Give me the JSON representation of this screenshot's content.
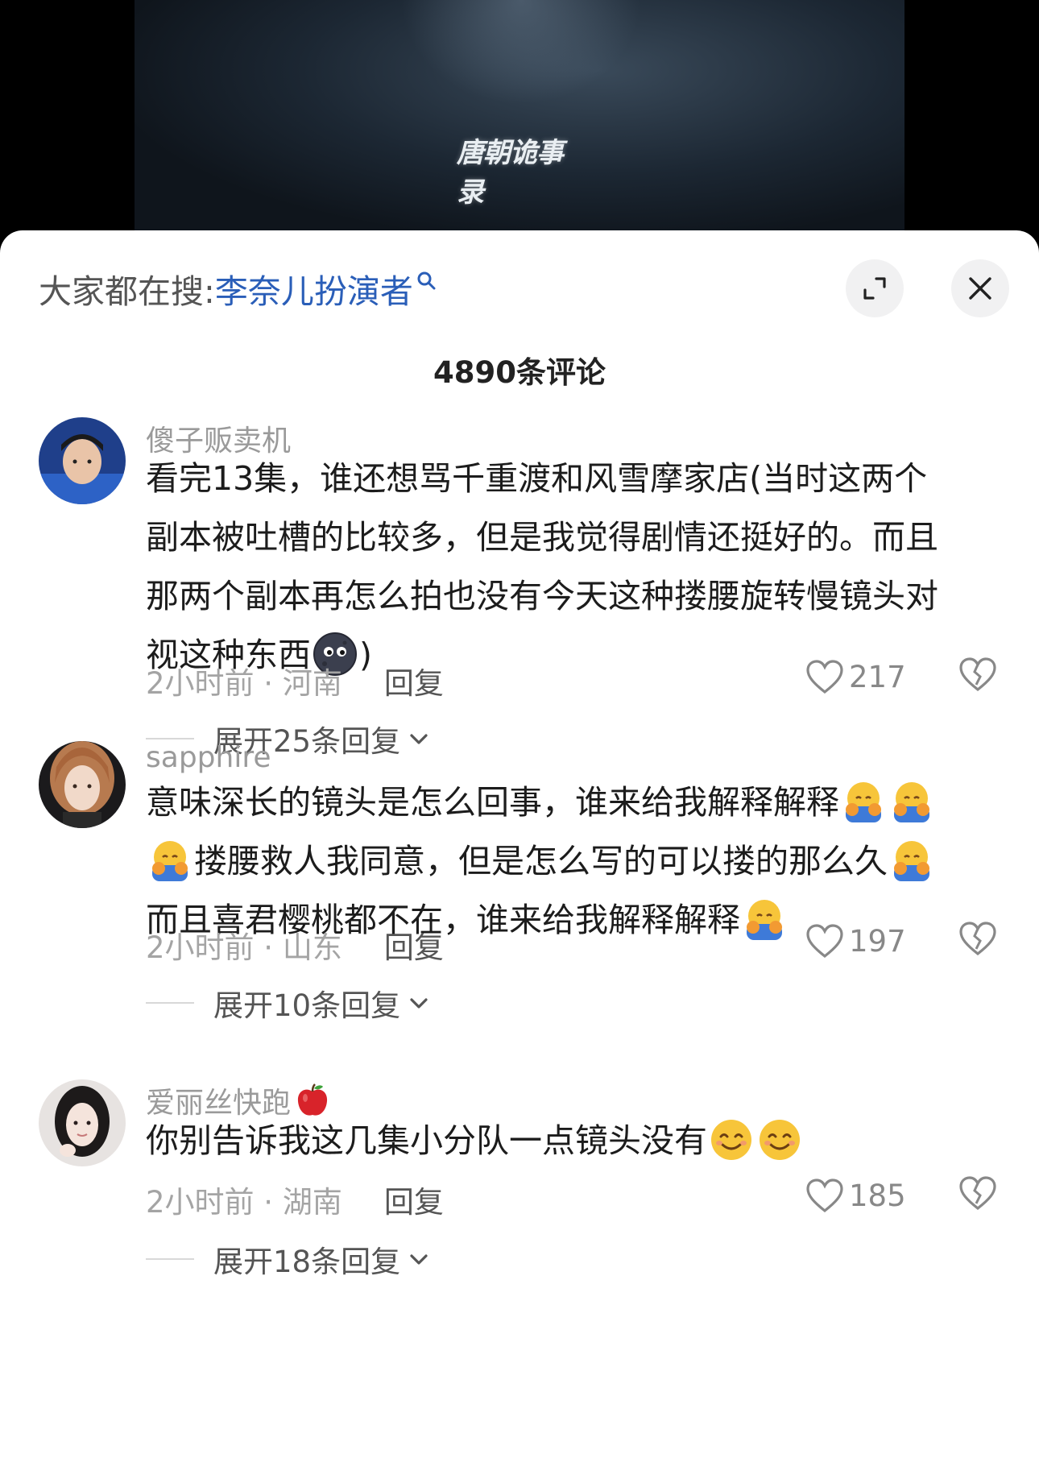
{
  "video": {
    "logo_text": "唐朝诡事录"
  },
  "search_hint": {
    "prefix": "大家都在搜:",
    "term": "李奈儿扮演者"
  },
  "comment_count": "4890条评论",
  "comments": [
    {
      "username": "傻子贩卖机",
      "lines": [
        "看完13集，谁还想骂千重渡和风雪摩家店(当时这两个",
        "副本被吐槽的比较多，但是我觉得剧情还挺好的。而且",
        "那两个副本再怎么拍也没有今天这种搂腰旋转慢镜头对",
        "视这种东西"
      ],
      "line4_tail": ")",
      "time_location": "2小时前 · 河南",
      "reply_label": "回复",
      "likes": "217",
      "expand_label": "展开25条回复"
    },
    {
      "username": "sapphire",
      "lines": [
        "意味深长的镜头是怎么回事，谁来给我解释解释",
        "搂腰救人我同意，但是怎么写的可以搂的那么久",
        "而且喜君樱桃都不在，谁来给我解释解释"
      ],
      "time_location": "2小时前 · 山东",
      "reply_label": "回复",
      "likes": "197",
      "expand_label": "展开10条回复"
    },
    {
      "username": "爱丽丝快跑",
      "lines": [
        "你别告诉我这几集小分队一点镜头没有"
      ],
      "time_location": "2小时前 · 湖南",
      "reply_label": "回复",
      "likes": "185",
      "expand_label": "展开18条回复"
    }
  ]
}
